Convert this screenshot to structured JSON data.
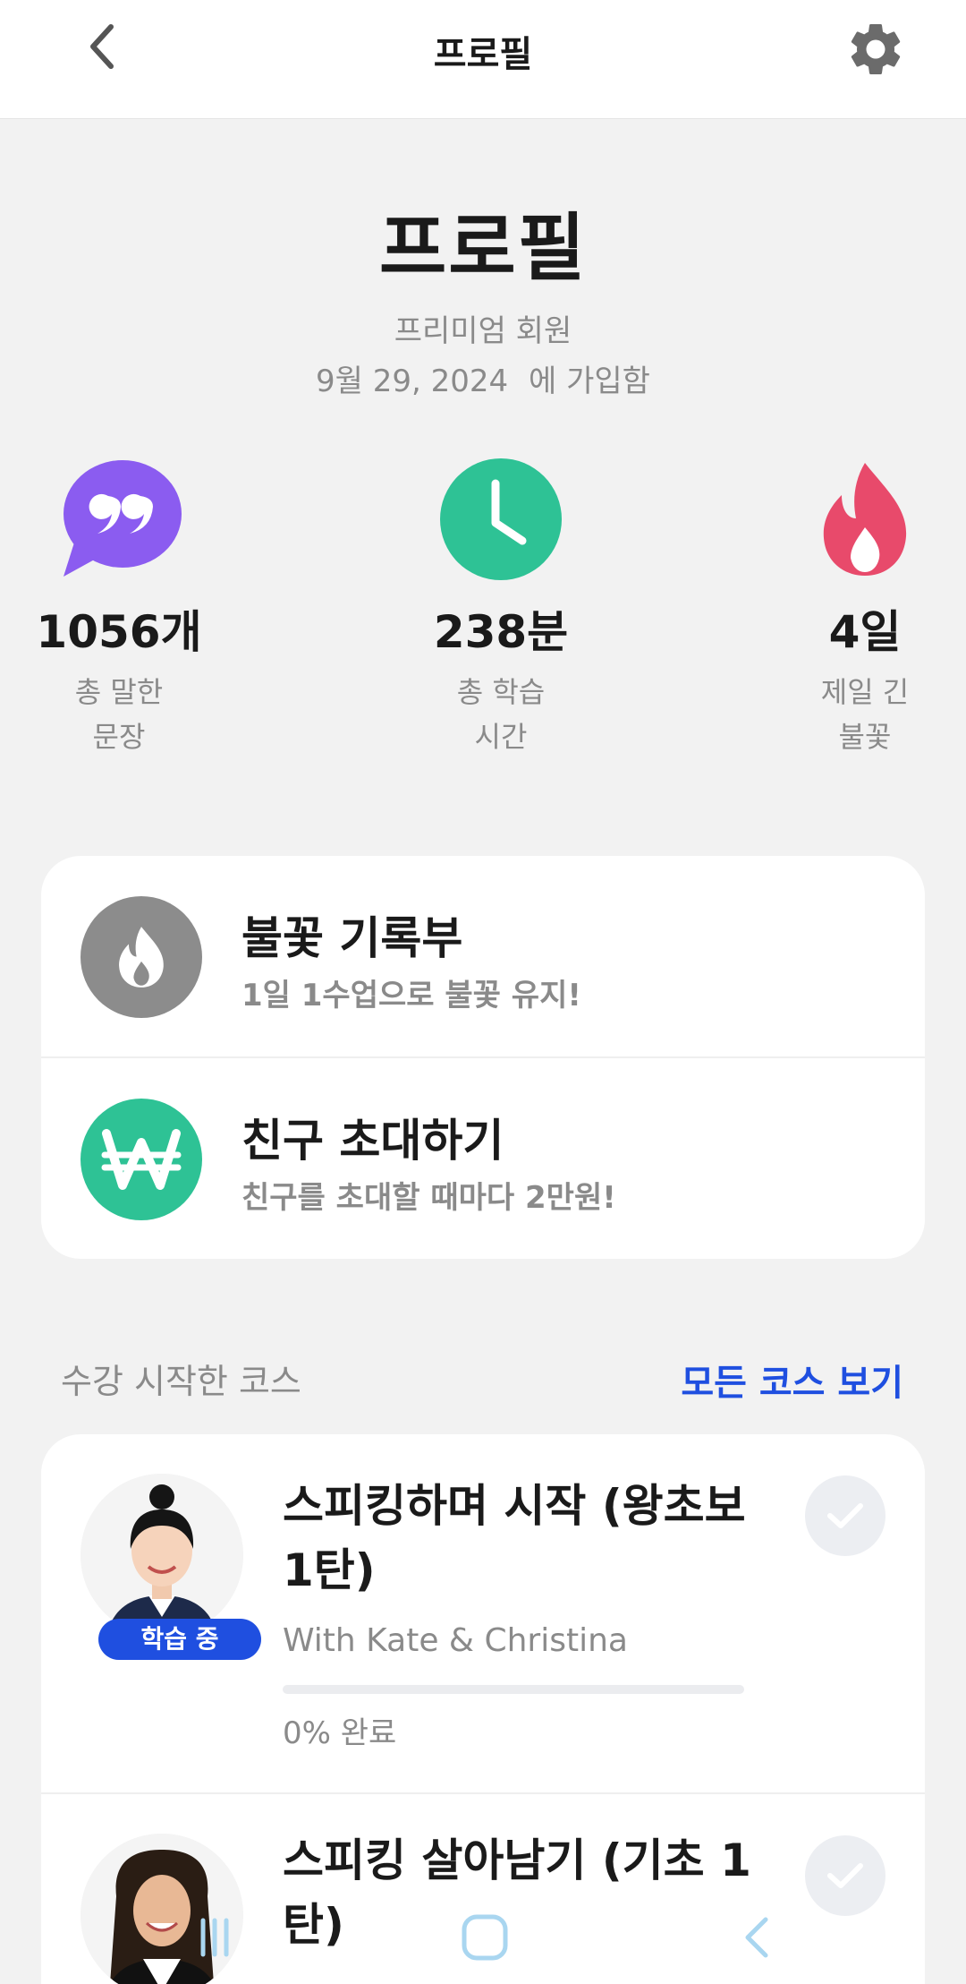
{
  "header": {
    "title": "프로필"
  },
  "profile": {
    "title": "프로필",
    "membership": "프리미엄 회원",
    "join_date": "9월 29, 2024",
    "join_suffix": "에 가입함"
  },
  "stats": [
    {
      "value": "1056개",
      "label": "총 말한\n문장",
      "icon": "quote-bubble-icon",
      "color": "#8b5cf0"
    },
    {
      "value": "238분",
      "label": "총 학습\n시간",
      "icon": "clock-icon",
      "color": "#2ec295"
    },
    {
      "value": "4일",
      "label": "제일 긴\n불꽃",
      "icon": "flame-icon",
      "color": "#e84a6b"
    }
  ],
  "menu": [
    {
      "title": "불꽃 기록부",
      "subtitle": "1일 1수업으로 불꽃 유지!",
      "icon": "flame-icon",
      "color": "#8c8c8c"
    },
    {
      "title": "친구 초대하기",
      "subtitle": "친구를 초대할 때마다 2만원!",
      "icon": "won-icon",
      "color": "#2ec295"
    }
  ],
  "courses_section": {
    "heading": "수강 시작한 코스",
    "view_all": "모든 코스 보기"
  },
  "courses": [
    {
      "title": "스피킹하며 시작 (왕초보 1탄)",
      "badge": "학습 중",
      "instructor": "With Kate & Christina",
      "progress": 0,
      "progress_label": "0% 완료"
    },
    {
      "title": "스피킹 살아남기 (기초 1탄)"
    }
  ],
  "colors": {
    "accent": "#1f4fe0",
    "background": "#f2f2f2"
  }
}
